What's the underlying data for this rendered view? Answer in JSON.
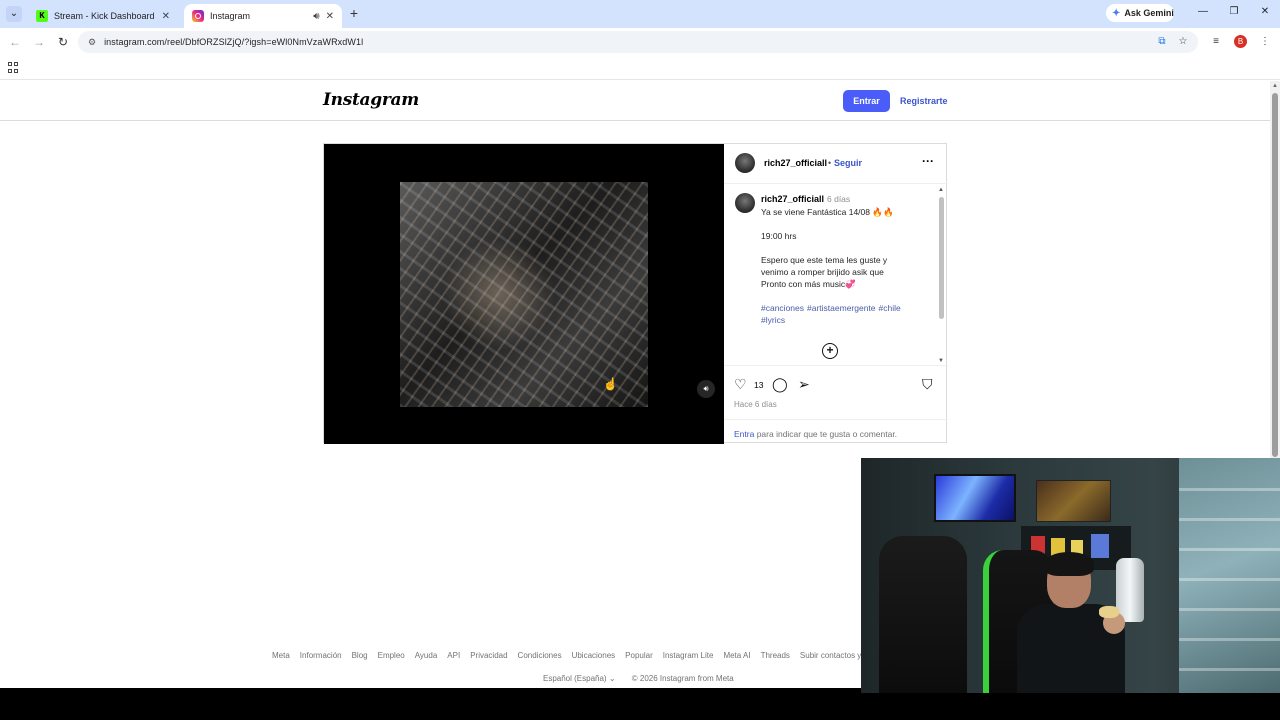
{
  "browser": {
    "tabs": [
      {
        "title": "Stream - Kick Dashboard",
        "favicon": "kick-icon",
        "active": false,
        "favicon_text": "K"
      },
      {
        "title": "Instagram",
        "favicon": "instagram-icon",
        "active": true
      }
    ],
    "ask_gemini_label": "Ask Gemini",
    "url": "instagram.com/reel/DbfORZSlZjQ/?igsh=eWl0NmVzaWRxdW1l",
    "profile_initial": "B",
    "accent_color": "#d3e3fd"
  },
  "instagram": {
    "logo_text": "Instagram",
    "header": {
      "login_label": "Entrar",
      "signup_label": "Registrarte"
    },
    "post": {
      "author": "rich27_officiall",
      "follow_label": "Seguir",
      "caption": {
        "username": "rich27_officiall",
        "time": "6 días",
        "lines": [
          "Ya se viene Fantástica 14/08 🔥🔥",
          "",
          "19:00 hrs",
          "",
          "Espero que este tema les guste y",
          "venimo a romper brijido asik que",
          "Pronto con más music💞"
        ],
        "hashtags": [
          "#canciones",
          "#artistaemergente",
          "#chile",
          "#lyrics"
        ]
      },
      "likes": "13",
      "posted_ago": "Hace 6 días",
      "login_prompt": {
        "link": "Entra",
        "rest": "para indicar que te gusta o comentar."
      }
    },
    "footer": {
      "links": [
        "Meta",
        "Información",
        "Blog",
        "Empleo",
        "Ayuda",
        "API",
        "Privacidad",
        "Condiciones",
        "Ubicaciones",
        "Popular",
        "Instagram Lite",
        "Meta AI",
        "Threads",
        "Subir contactos y"
      ],
      "language": "Español (España)",
      "copyright": "© 2026 Instagram from Meta"
    },
    "brand_color": "#4a5df9",
    "link_color": "#3b55c8"
  }
}
